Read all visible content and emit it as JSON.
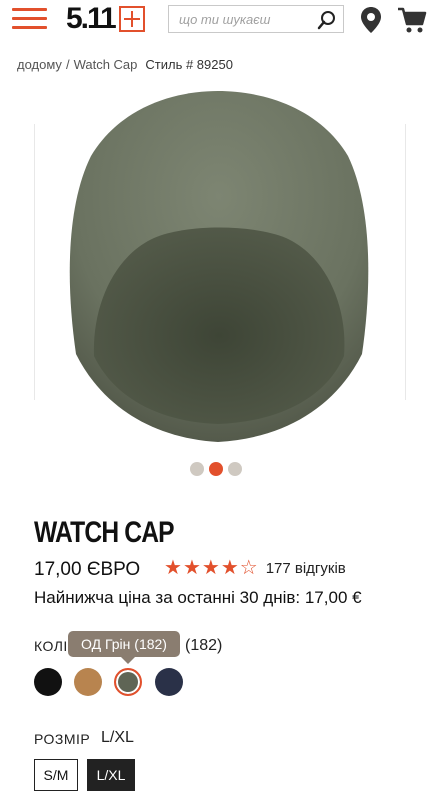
{
  "header": {
    "logo_text": "5.11",
    "search_placeholder": "що ти шукаєш"
  },
  "breadcrumb": {
    "home": "додому",
    "separator": "/",
    "current": "Watch Cap",
    "style": "Стиль # 89250"
  },
  "gallery": {
    "dots": [
      false,
      true,
      false
    ]
  },
  "product": {
    "title": "WATCH CAP",
    "price": "17,00 ЄВРО",
    "rating": 4.5,
    "reviews": "177 відгуків",
    "lowest_price": "Найнижча ціна за останні 30 днів: 17,00 €",
    "color_label": "КОЛІР",
    "color_code": "(182)",
    "tooltip": "ОД Грін (182)",
    "swatches": [
      "#111111",
      "#b8844f",
      "#5f6555",
      "#2a3148"
    ],
    "size_label": "РОЗМІР",
    "size_value": "L/XL",
    "sizes": [
      "S/M",
      "L/XL"
    ]
  },
  "colors": {
    "accent": "#e2502c",
    "tooltip_bg": "#8a7d70"
  }
}
